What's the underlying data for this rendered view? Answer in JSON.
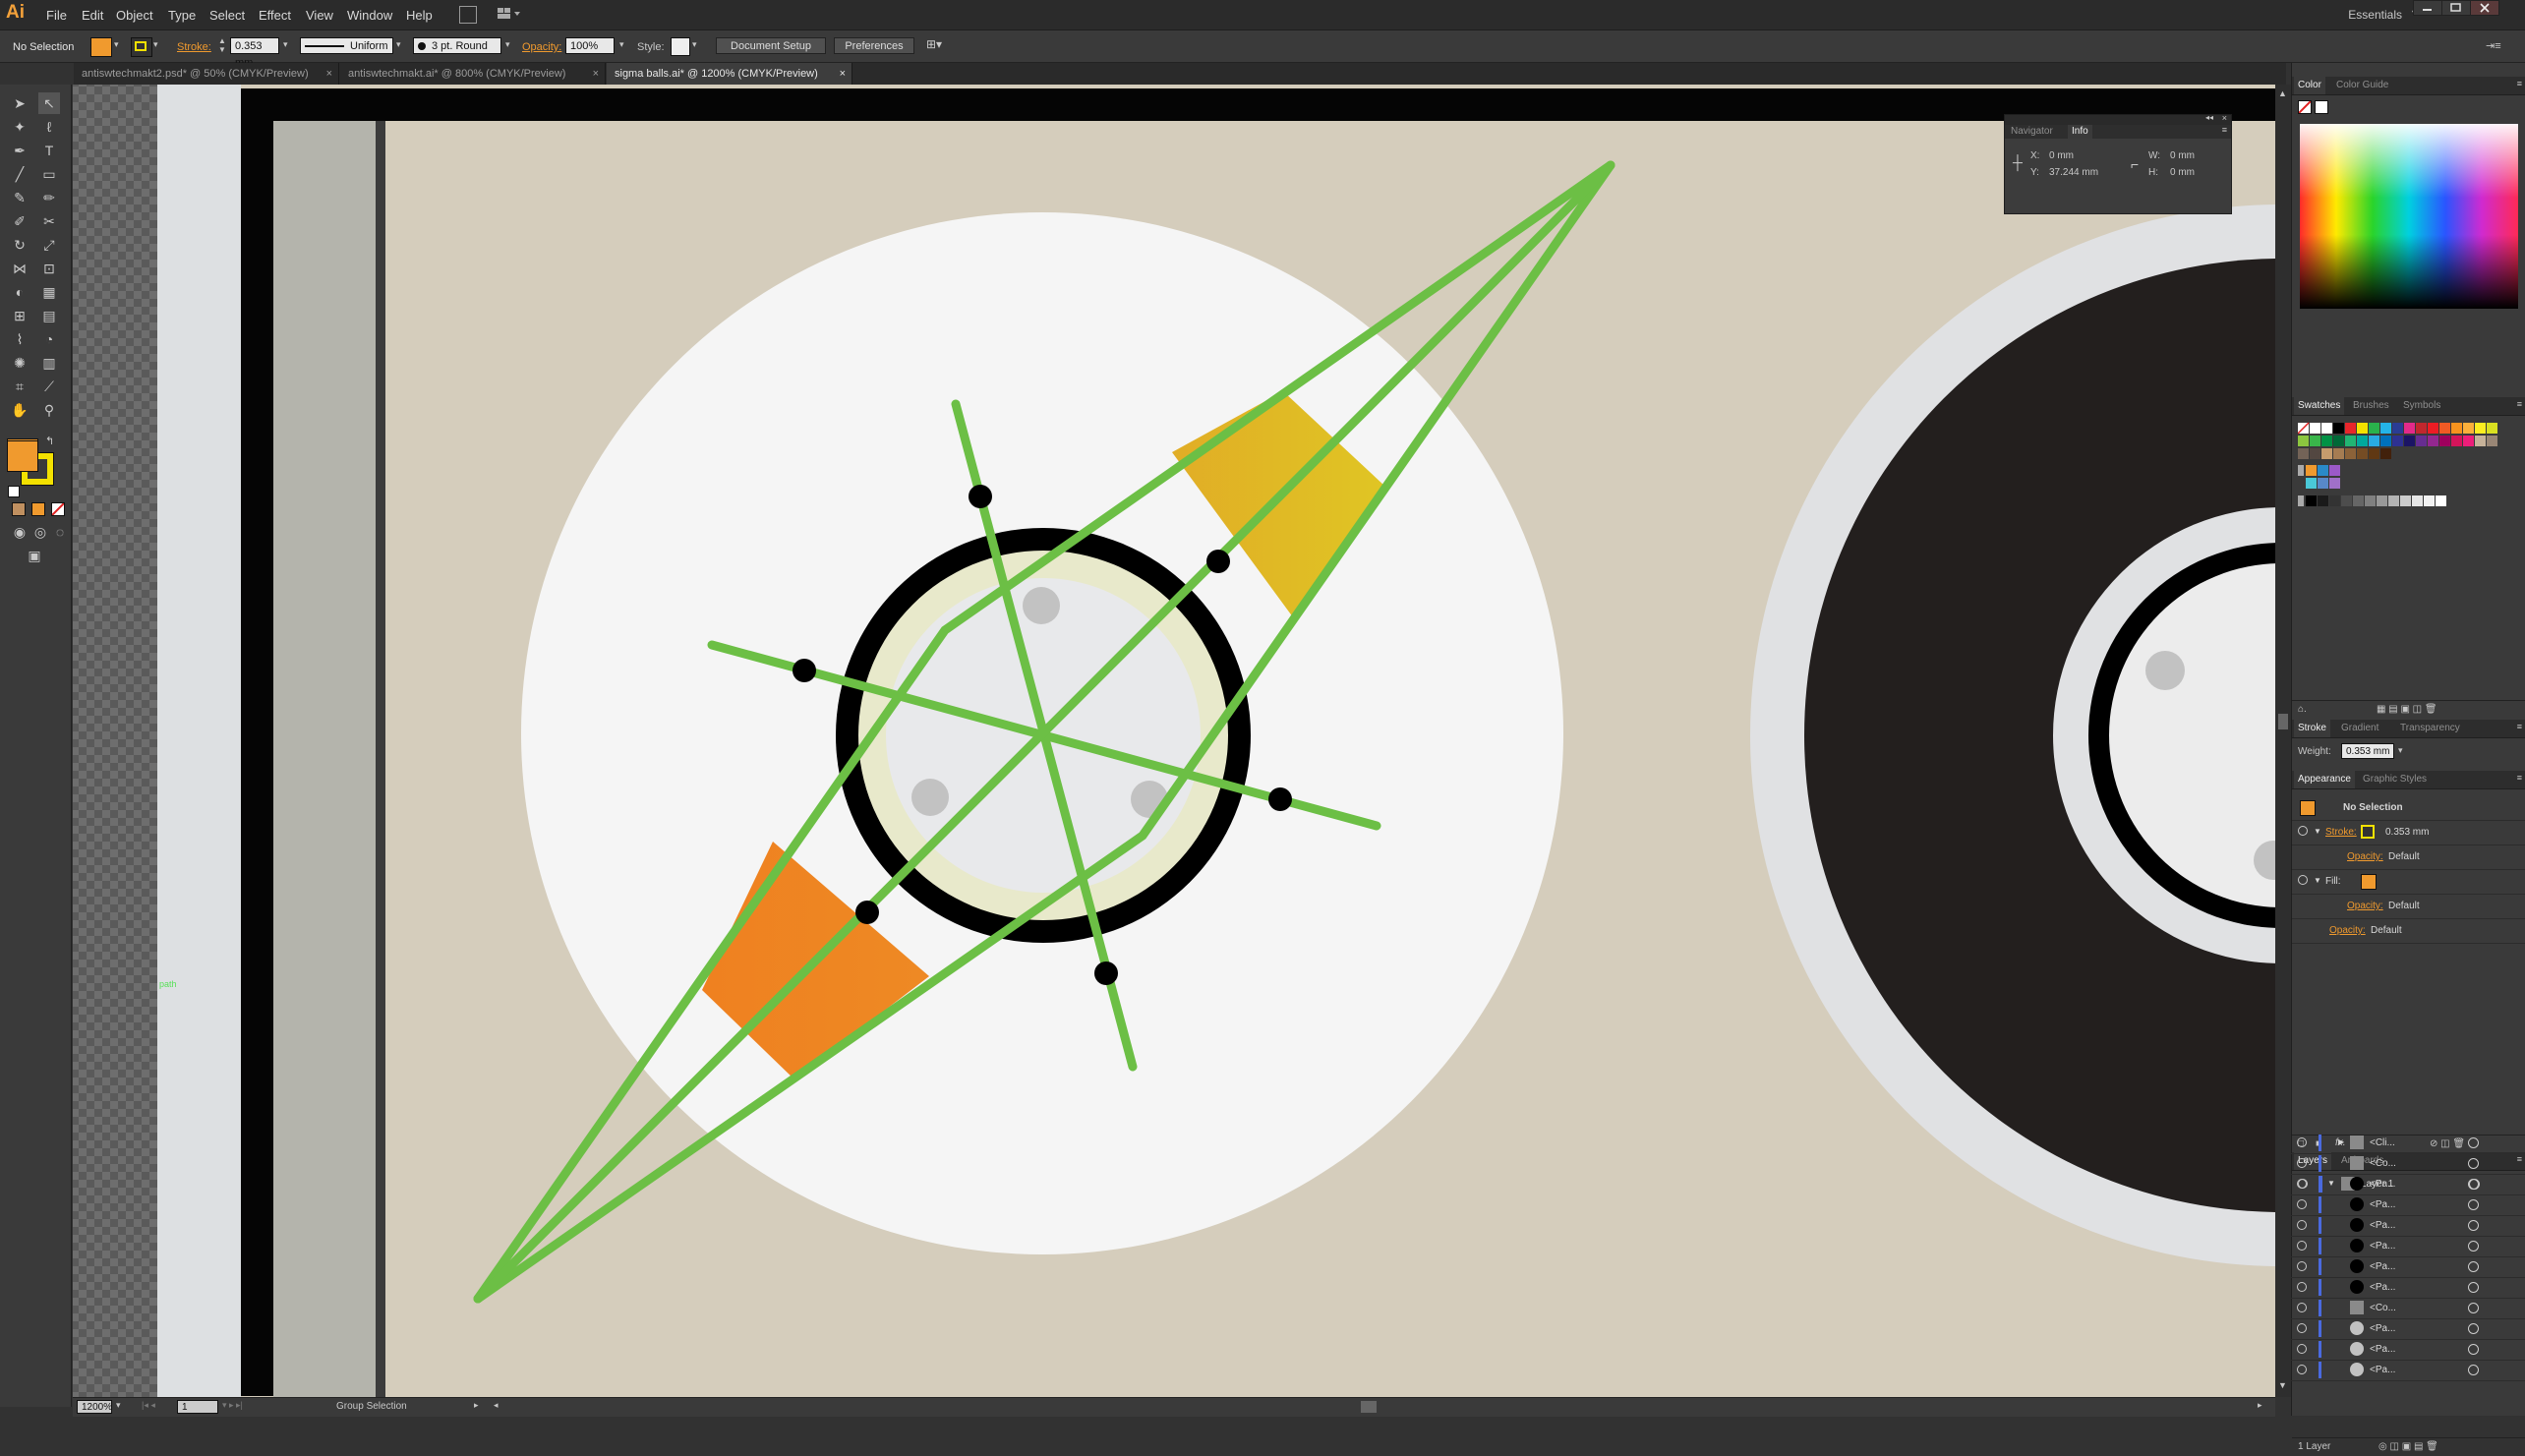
{
  "app": {
    "logo": "Ai",
    "workspace": "Essentials"
  },
  "menu": [
    "File",
    "Edit",
    "Object",
    "Type",
    "Select",
    "Effect",
    "View",
    "Window",
    "Help"
  ],
  "control": {
    "selection": "No Selection",
    "stroke_label": "Stroke:",
    "stroke_weight": "0.353 mm",
    "stroke_style": "Uniform",
    "brush": "3 pt. Round",
    "opacity_label": "Opacity:",
    "opacity": "100%",
    "style_label": "Style:",
    "doc_setup": "Document Setup",
    "preferences": "Preferences"
  },
  "tabs": [
    {
      "label": "antiswtechmakt2.psd* @ 50% (CMYK/Preview)",
      "active": false
    },
    {
      "label": "antiswtechmakt.ai* @ 800% (CMYK/Preview)",
      "active": false
    },
    {
      "label": "sigma balls.ai* @ 1200% (CMYK/Preview)",
      "active": true
    }
  ],
  "info_panel": {
    "tabs": [
      "Navigator",
      "Info"
    ],
    "x_label": "X:",
    "x": "0 mm",
    "y_label": "Y:",
    "y": "37.244 mm",
    "w_label": "W:",
    "w": "0 mm",
    "h_label": "H:",
    "h": "0 mm"
  },
  "canvas": {
    "path_label": "path"
  },
  "status": {
    "zoom": "1200%",
    "page": "1",
    "tool": "Group Selection"
  },
  "color_panel": {
    "tabs": [
      "Color",
      "Color Guide"
    ]
  },
  "swatches_panel": {
    "tabs": [
      "Swatches",
      "Brushes",
      "Symbols"
    ]
  },
  "stroke_panel": {
    "tabs": [
      "Stroke",
      "Gradient",
      "Transparency"
    ],
    "weight_label": "Weight:",
    "weight": "0.353 mm"
  },
  "appearance_panel": {
    "tabs": [
      "Appearance",
      "Graphic Styles"
    ],
    "selection": "No Selection",
    "stroke_label": "Stroke:",
    "stroke_value": "0.353 mm",
    "opacity_label": "Opacity:",
    "opacity_value": "Default",
    "fill_label": "Fill:",
    "fx": "fx."
  },
  "layers_panel": {
    "tabs": [
      "Layers",
      "Artboards"
    ],
    "layer_name": "Layer 1",
    "items": [
      "<Cli...",
      "<Co...",
      "<Pa...",
      "<Pa...",
      "<Pa...",
      "<Pa...",
      "<Pa...",
      "<Pa...",
      "<Co...",
      "<Pa...",
      "<Pa...",
      "<Pa..."
    ],
    "footer": "1 Layer"
  },
  "colors": {
    "accent": "#f09a2e",
    "green": "#6cbf45",
    "orange": "#ef8020",
    "yellow": "#e2bf24",
    "beige": "#d5cdbc",
    "dark": "#231f1e"
  }
}
